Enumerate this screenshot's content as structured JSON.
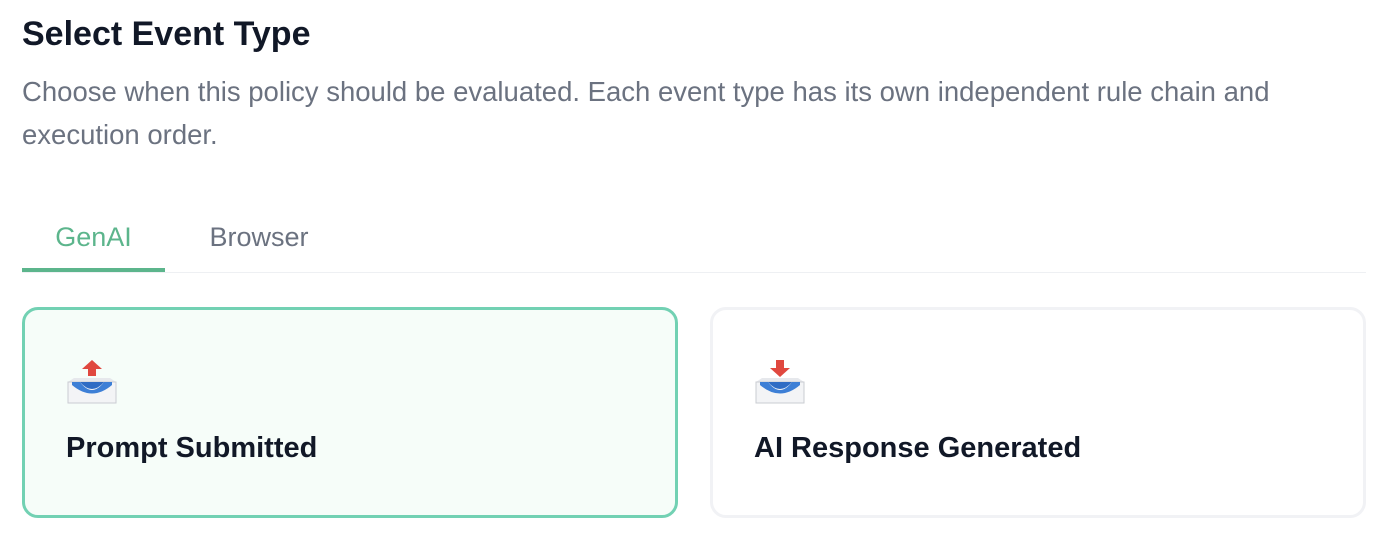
{
  "header": {
    "title": "Select Event Type",
    "description": "Choose when this policy should be evaluated. Each event type has its own independent rule chain and execution order."
  },
  "tabs": [
    {
      "label": "GenAI",
      "active": true
    },
    {
      "label": "Browser",
      "active": false
    }
  ],
  "event_types": [
    {
      "label": "Prompt Submitted",
      "icon": "outbox-tray-icon",
      "selected": true
    },
    {
      "label": "AI Response Generated",
      "icon": "inbox-tray-icon",
      "selected": false
    }
  ],
  "colors": {
    "accent": "#5cb58c",
    "selected_border": "#72d1b3",
    "selected_background": "#f6fdf9",
    "title_text": "#111827",
    "muted_text": "#6b7280",
    "icon_arrow": "#e0483f",
    "icon_tray": "#3d7fd6"
  }
}
